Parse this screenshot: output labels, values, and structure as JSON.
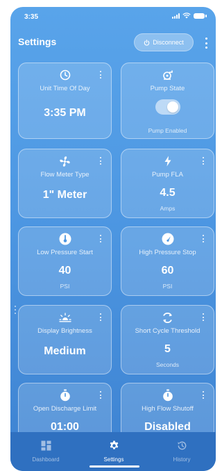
{
  "status_bar": {
    "time": "3:35"
  },
  "header": {
    "title": "Settings",
    "disconnect_label": "Disconnect"
  },
  "cards": [
    {
      "icon": "clock-icon",
      "label": "Unit Time Of Day",
      "value": "3:35 PM",
      "unit": ""
    },
    {
      "icon": "pump-icon",
      "label": "Pump State",
      "toggle_on": true,
      "value": "",
      "unit": "Pump Enabled"
    },
    {
      "icon": "fan-icon",
      "label": "Flow Meter Type",
      "value": "1\" Meter",
      "unit": ""
    },
    {
      "icon": "lightning-icon",
      "label": "Pump FLA",
      "value": "4.5",
      "unit": "Amps"
    },
    {
      "icon": "thermometer-icon",
      "label": "Low Pressure Start",
      "value": "40",
      "unit": "PSI"
    },
    {
      "icon": "gauge-icon",
      "label": "High Pressure Stop",
      "value": "60",
      "unit": "PSI"
    },
    {
      "icon": "brightness-icon",
      "label": "Display Brightness",
      "value": "Medium",
      "unit": ""
    },
    {
      "icon": "cycle-icon",
      "label": "Short Cycle Threshold",
      "value": "5",
      "unit": "Seconds"
    },
    {
      "icon": "timer-icon",
      "label": "Open Discharge Limit",
      "value": "01:00",
      "unit": ""
    },
    {
      "icon": "timer-icon",
      "label": "High Flow Shutoff",
      "value": "Disabled",
      "unit": ""
    }
  ],
  "bottom_nav": {
    "items": [
      {
        "icon": "dashboard-icon",
        "label": "Dashboard",
        "active": false
      },
      {
        "icon": "gear-icon",
        "label": "Settings",
        "active": true
      },
      {
        "icon": "history-icon",
        "label": "History",
        "active": false
      }
    ]
  },
  "colors": {
    "background_top": "#59a4ea",
    "background_bottom": "#3d82d1",
    "nav_background": "#2f70c0"
  }
}
